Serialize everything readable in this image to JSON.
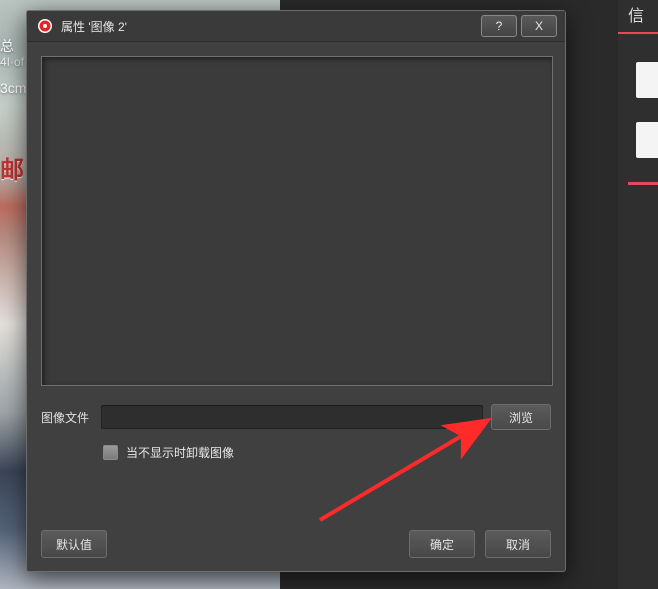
{
  "background": {
    "text_top1": "总",
    "text_top2": "4I·of",
    "text_top3": "3cm",
    "text_red": "邮"
  },
  "right_panel": {
    "title_trunc": "信"
  },
  "dialog": {
    "title": "属性 '图像 2'",
    "titlebar": {
      "help_symbol": "?",
      "close_symbol": "X"
    },
    "file_label": "图像文件",
    "file_value": "",
    "browse_label": "浏览",
    "checkbox_label": "当不显示时卸载图像",
    "checkbox_checked": false,
    "buttons": {
      "defaults": "默认值",
      "ok": "确定",
      "cancel": "取消"
    }
  }
}
